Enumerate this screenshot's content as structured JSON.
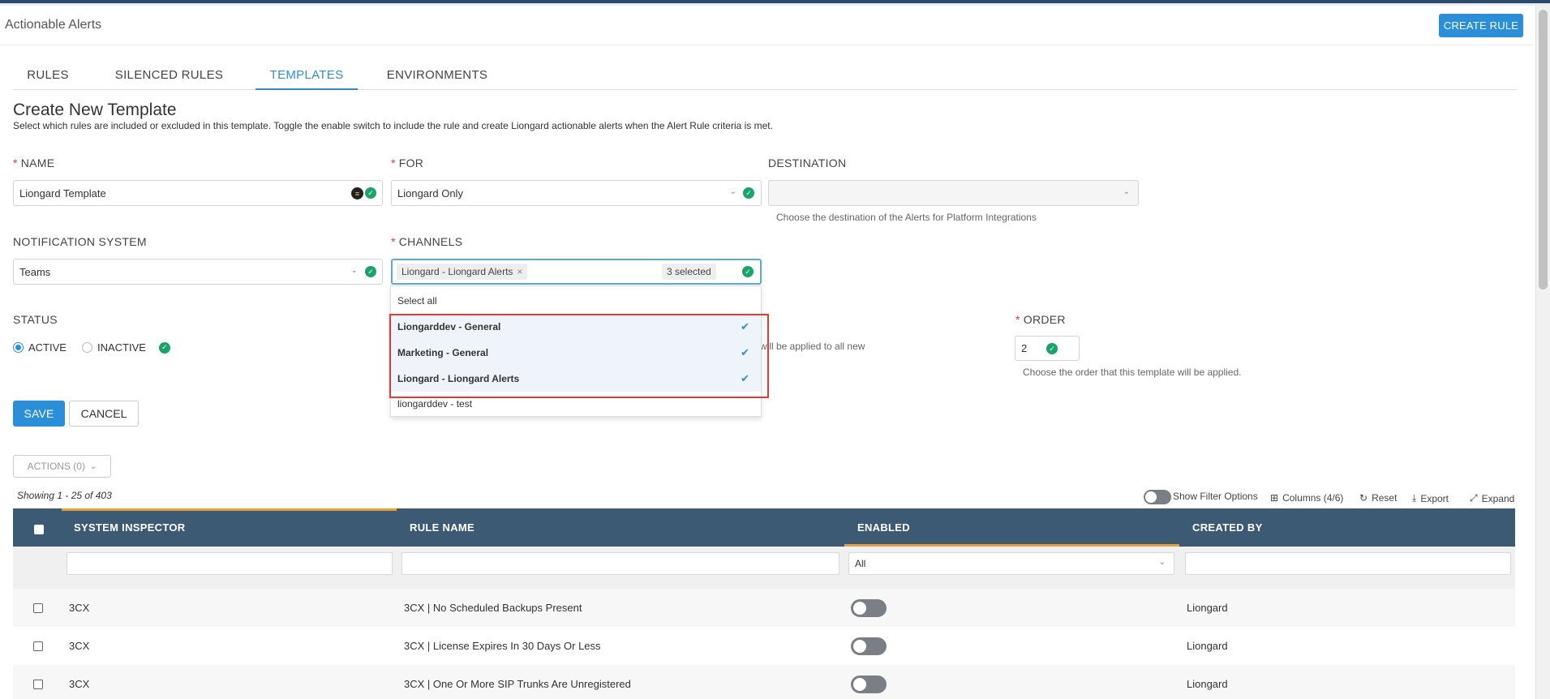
{
  "app": {
    "title": "Actionable Alerts",
    "create_rule_label": "CREATE RULE"
  },
  "tabs": [
    {
      "label": "RULES",
      "active": false
    },
    {
      "label": "SILENCED RULES",
      "active": false
    },
    {
      "label": "TEMPLATES",
      "active": true
    },
    {
      "label": "ENVIRONMENTS",
      "active": false
    }
  ],
  "form": {
    "title": "Create New Template",
    "description": "Select which rules are included or excluded in this template. Toggle the enable switch to include the rule and create Liongard actionable alerts when the Alert Rule criteria is met.",
    "name": {
      "label": "NAME",
      "value": "Liongard Template"
    },
    "for": {
      "label": "FOR",
      "value": "Liongard Only"
    },
    "destination": {
      "label": "DESTINATION",
      "value": "",
      "hint": "Choose the destination of the Alerts for Platform Integrations"
    },
    "notification_system": {
      "label": "NOTIFICATION SYSTEM",
      "value": "Teams"
    },
    "channels": {
      "label": "CHANNELS",
      "chip": "Liongard - Liongard Alerts",
      "chip_close": "×",
      "selected_count": "3 selected",
      "select_all": "Select all",
      "options": [
        {
          "label": "Liongarddev - General",
          "selected": true
        },
        {
          "label": "Marketing - General",
          "selected": true
        },
        {
          "label": "Liongard - Liongard Alerts",
          "selected": true
        },
        {
          "label": "liongarddev - test",
          "selected": false
        }
      ]
    },
    "status": {
      "label": "STATUS",
      "active_label": "ACTIVE",
      "inactive_label": "INACTIVE",
      "value": "ACTIVE"
    },
    "obscured_hint": "will be applied to all new",
    "order": {
      "label": "ORDER",
      "value": "2",
      "hint": "Choose the order that this template will be applied."
    },
    "save_label": "SAVE",
    "cancel_label": "CANCEL"
  },
  "table_toolbar": {
    "actions_label": "ACTIONS (0)",
    "showing": "Showing 1 - 25 of 403",
    "show_filter_label": "Show Filter Options",
    "columns_label": "Columns (4/6)",
    "reset_label": "Reset",
    "export_label": "Export",
    "expand_label": "Expand"
  },
  "table": {
    "columns": [
      "SYSTEM INSPECTOR",
      "RULE NAME",
      "ENABLED",
      "CREATED BY"
    ],
    "enabled_filter": "All",
    "rows": [
      {
        "inspector": "3CX",
        "rule": "3CX | No Scheduled Backups Present",
        "enabled": false,
        "created_by": "Liongard"
      },
      {
        "inspector": "3CX",
        "rule": "3CX | License Expires In 30 Days Or Less",
        "enabled": false,
        "created_by": "Liongard"
      },
      {
        "inspector": "3CX",
        "rule": "3CX | One Or More SIP Trunks Are Unregistered",
        "enabled": false,
        "created_by": "Liongard"
      }
    ]
  },
  "colors": {
    "accent": "#2a8fd8",
    "header_bg": "#3d5a75",
    "success": "#1aa36b",
    "highlight": "#e53935",
    "sort_accent": "#e6a03b"
  }
}
